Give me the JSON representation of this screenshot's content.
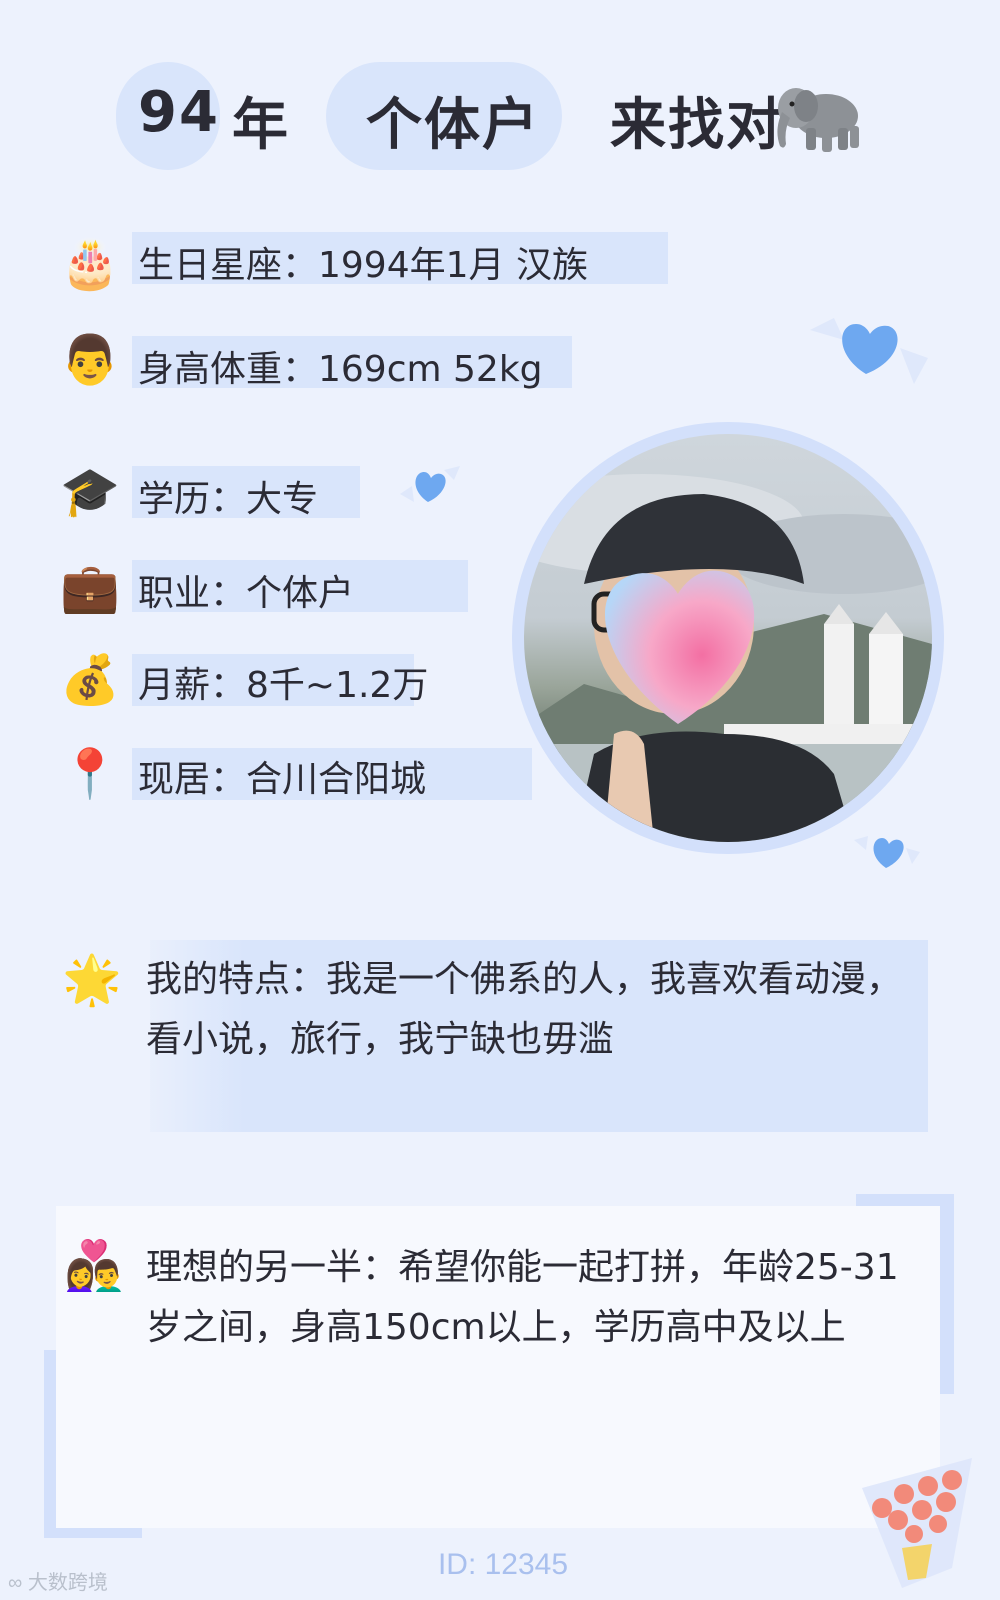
{
  "header": {
    "year": "94",
    "year_suffix": "年",
    "occupation": "个体户",
    "seeking": "来找对",
    "seeking_emoji": "🐘"
  },
  "info": [
    {
      "emoji": "🎂",
      "icon": "birthday-cake-icon",
      "text": "生日星座：1994年1月 汉族"
    },
    {
      "emoji": "👨",
      "icon": "man-face-icon",
      "text": "身高体重：169cm 52kg"
    },
    {
      "emoji": "🎓",
      "icon": "graduation-cap-icon",
      "text": "学历：大专"
    },
    {
      "emoji": "💼",
      "icon": "briefcase-icon",
      "text": "职业：个体户"
    },
    {
      "emoji": "💰",
      "icon": "money-bag-icon",
      "text": "月薪：8千~1.2万"
    },
    {
      "emoji": "📍",
      "icon": "location-pin-icon",
      "text": "现居：合川合阳城"
    }
  ],
  "features": {
    "emoji": "🌟",
    "icon": "star-icon",
    "text": "我的特点：我是一个佛系的人，我喜欢看动漫，看小说，旅行，我宁缺也毋滥"
  },
  "ideal": {
    "emoji": "👩‍❤️‍👨",
    "icon": "couple-heart-icon",
    "text": "理想的另一半：希望你能一起打拼，年龄25-31岁之间，身高150cm以上，学历高中及以上"
  },
  "footer": {
    "id": "ID: 12345",
    "watermark": "大数跨境"
  },
  "colors": {
    "background": "#edf2fd",
    "accent": "#d9e5fb",
    "heart": "#6ea8f0",
    "id_text": "#a9c0ee"
  }
}
